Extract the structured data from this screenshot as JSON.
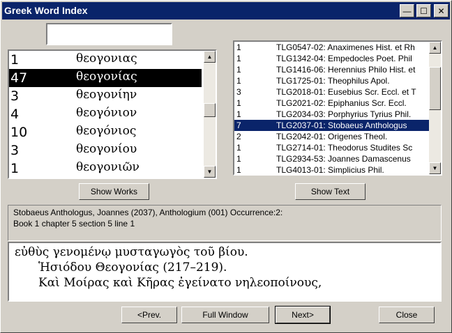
{
  "window": {
    "title": "Greek Word Index",
    "minimize_symbol": "—",
    "maximize_symbol": "☐",
    "close_symbol": "✕"
  },
  "search": {
    "value": ""
  },
  "word_list": [
    {
      "count": "1",
      "word": "θεογονιας",
      "selected": false
    },
    {
      "count": "47",
      "word": "θεογονίας",
      "selected": true
    },
    {
      "count": "3",
      "word": "θεογονίην",
      "selected": false
    },
    {
      "count": "4",
      "word": "θεογόνιον",
      "selected": false
    },
    {
      "count": "10",
      "word": "θεογόνιος",
      "selected": false
    },
    {
      "count": "3",
      "word": "θεογονίου",
      "selected": false
    },
    {
      "count": "1",
      "word": "θεογονιῶν",
      "selected": false
    }
  ],
  "word_scroll": {
    "position": 0.45
  },
  "works_list": [
    {
      "count": "1",
      "ref": "TLG0547-02: Anaximenes Hist. et Rh",
      "selected": false
    },
    {
      "count": "1",
      "ref": "TLG1342-04: Empedocles Poet. Phil",
      "selected": false
    },
    {
      "count": "1",
      "ref": "TLG1416-06: Herennius Philo Hist. et",
      "selected": false
    },
    {
      "count": "1",
      "ref": "TLG1725-01: Theophilus Apol.",
      "selected": false
    },
    {
      "count": "3",
      "ref": "TLG2018-01: Eusebius Scr. Eccl. et T",
      "selected": false
    },
    {
      "count": "1",
      "ref": "TLG2021-02: Epiphanius Scr. Eccl.",
      "selected": false
    },
    {
      "count": "1",
      "ref": "TLG2034-03: Porphyrius Tyrius Phil.",
      "selected": false
    },
    {
      "count": "7",
      "ref": "TLG2037-01: Stobaeus Anthologus",
      "selected": true
    },
    {
      "count": "2",
      "ref": "TLG2042-01: Origenes Theol.",
      "selected": false
    },
    {
      "count": "1",
      "ref": "TLG2714-01: Theodorus Studites Sc",
      "selected": false
    },
    {
      "count": "1",
      "ref": "TLG2934-53: Joannes Damascenus",
      "selected": false
    },
    {
      "count": "1",
      "ref": "TLG4013-01: Simplicius Phil.",
      "selected": false
    }
  ],
  "works_scroll": {
    "position": 0.2
  },
  "buttons": {
    "show_works": "Show Works",
    "show_text": "Show Text",
    "prev": "<Prev.",
    "full_window": "Full Window",
    "next": "Next>",
    "close": "Close"
  },
  "info": {
    "line1": "Stobaeus Anthologus, Joannes  (2037), Anthologium (001) Occurrence:2:",
    "line2": "Book 1 chapter 5 section 5 line 1"
  },
  "text": {
    "line1": "εὐθὺς γενομένῳ μυσταγωγὸς τοῦ βίου.",
    "line2": "Ἡσιόδου Θεογονίας (217–219).",
    "line3": "Καὶ Μοίρας καὶ Κῆρας ἐγείνατο νηλεοποίνους,"
  },
  "icons": [
    "minimize-icon",
    "maximize-icon",
    "close-icon",
    "scroll-up-icon",
    "scroll-down-icon"
  ]
}
